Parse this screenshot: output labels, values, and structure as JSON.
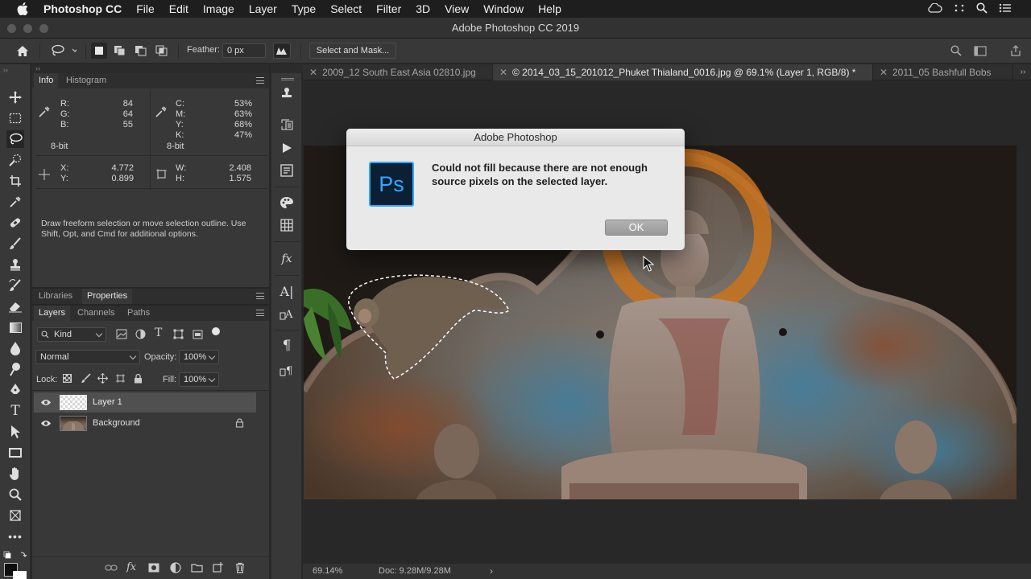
{
  "menubar": {
    "app_name": "Photoshop CC",
    "items": [
      "File",
      "Edit",
      "Image",
      "Layer",
      "Type",
      "Select",
      "Filter",
      "3D",
      "View",
      "Window",
      "Help"
    ]
  },
  "window_title": "Adobe Photoshop CC 2019",
  "options_bar": {
    "feather_label": "Feather:",
    "feather_value": "0 px",
    "select_and_mask": "Select and Mask..."
  },
  "info_panel": {
    "tabs": [
      "Info",
      "Histogram"
    ],
    "r_label": "R:",
    "r_value": "84",
    "g_label": "G:",
    "g_value": "64",
    "b_label": "B:",
    "b_value": "55",
    "rgb_bit": "8-bit",
    "c_label": "C:",
    "c_value": "53%",
    "m_label": "M:",
    "m_value": "63%",
    "y_label": "Y:",
    "y_value": "68%",
    "k_label": "K:",
    "k_value": "47%",
    "cmyk_bit": "8-bit",
    "x_label": "X:",
    "x_value": "4.772",
    "y2_label": "Y:",
    "y2_value": "0.899",
    "w_label": "W:",
    "w_value": "2.408",
    "h_label": "H:",
    "h_value": "1.575",
    "hint": "Draw freeform selection or move selection outline.  Use Shift, Opt, and Cmd for additional options."
  },
  "lib_props_tabs": [
    "Libraries",
    "Properties"
  ],
  "layers_panel": {
    "tabs": [
      "Layers",
      "Channels",
      "Paths"
    ],
    "filter_kind": "Kind",
    "blend_mode": "Normal",
    "opacity_label": "Opacity:",
    "opacity_value": "100%",
    "lock_label": "Lock:",
    "fill_label": "Fill:",
    "fill_value": "100%",
    "layers": [
      {
        "name": "Layer 1"
      },
      {
        "name": "Background"
      }
    ]
  },
  "doc_tabs": [
    {
      "label": "2009_12 South East Asia 02810.jpg",
      "active": false
    },
    {
      "label": "© 2014_03_15_201012_Phuket Thialand_0016.jpg @ 69.1% (Layer 1, RGB/8) *",
      "active": true
    },
    {
      "label": "2011_05 Bashfull Bobs",
      "active": false
    }
  ],
  "status_bar": {
    "zoom": "69.14%",
    "doc_size": "Doc: 9.28M/9.28M"
  },
  "dialog": {
    "title": "Adobe Photoshop",
    "logo_text": "Ps",
    "message": "Could not fill because there are not enough source pixels on the selected layer.",
    "ok_label": "OK"
  },
  "colors": {
    "accent_ps": "#31a8ff",
    "panel_bg": "#383838",
    "canvas_bg": "#282828"
  }
}
